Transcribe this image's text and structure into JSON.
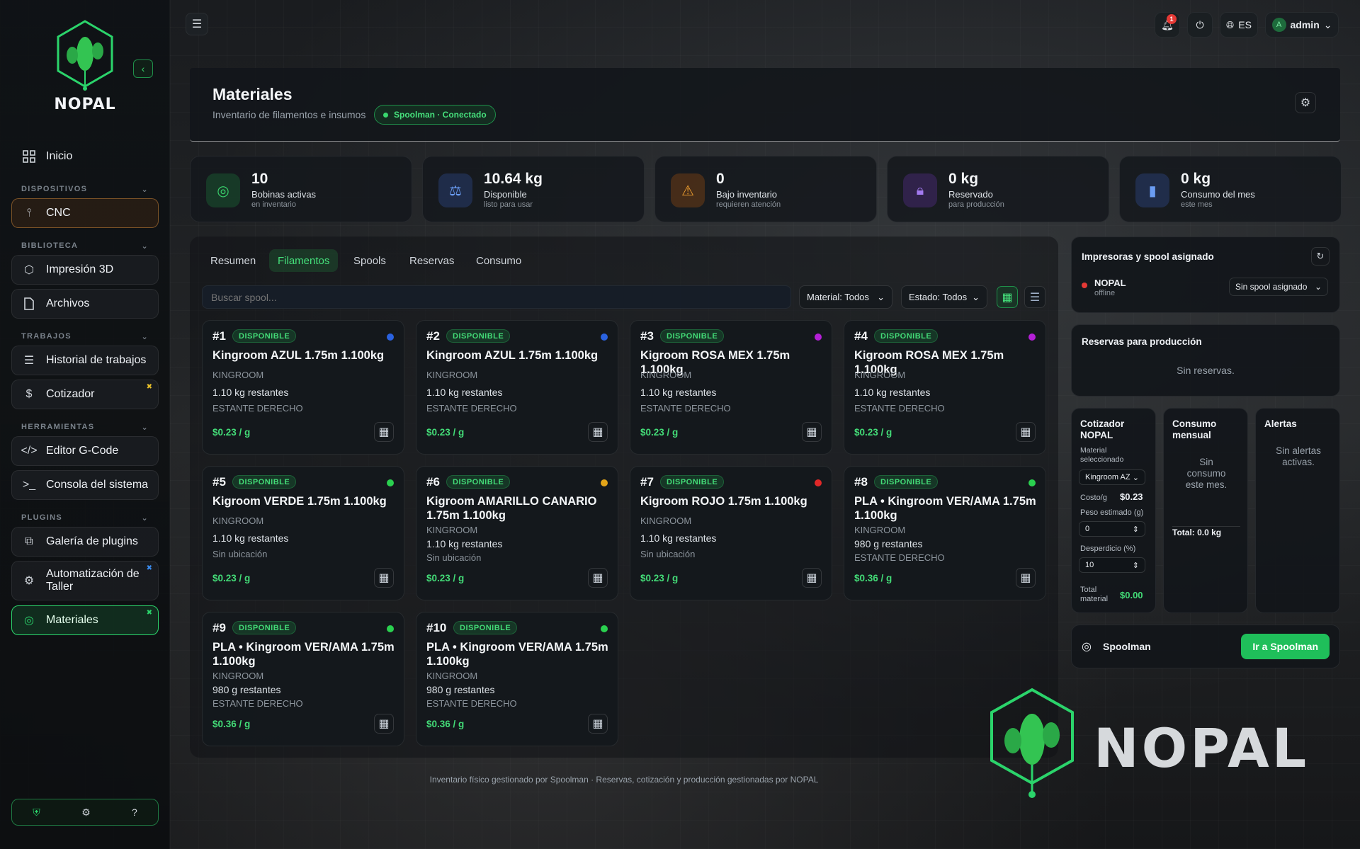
{
  "app": {
    "brand": "NOPAL",
    "colors": {
      "accent": "#2bd46b",
      "background": "#121417",
      "panel": "#14181c",
      "warning": "#e0a030"
    }
  },
  "sidebar": {
    "sections": {
      "dispositivos": "DISPOSITIVOS",
      "biblioteca": "BIBLIOTECA",
      "trabajos": "TRABAJOS",
      "herramientas": "HERRAMIENTAS",
      "plugins": "PLUGINS"
    },
    "items": {
      "inicio": "Inicio",
      "cnc": "CNC",
      "impresion": "Impresión 3D",
      "archivos": "Archivos",
      "historial": "Historial de trabajos",
      "cotizador": "Cotizador",
      "editor": "Editor G-Code",
      "consola": "Consola del sistema",
      "galeria": "Galería de plugins",
      "automatizacion": "Automatización de Taller",
      "materiales": "Materiales"
    }
  },
  "topbar": {
    "notifications_count": "1",
    "language": "ES",
    "user": "admin",
    "avatar_letter": "A"
  },
  "header": {
    "title": "Materiales",
    "subtitle": "Inventario de filamentos e insumos",
    "status": "Spoolman · Conectado"
  },
  "stats": [
    {
      "value": "10",
      "label": "Bobinas activas",
      "sub": "en inventario",
      "icon": "target-icon"
    },
    {
      "value": "10.64 kg",
      "label": "Disponible",
      "sub": "listo para usar",
      "icon": "scale-icon"
    },
    {
      "value": "0",
      "label": "Bajo inventario",
      "sub": "requieren atención",
      "icon": "warning-icon"
    },
    {
      "value": "0 kg",
      "label": "Reservado",
      "sub": "para producción",
      "icon": "lock-icon"
    },
    {
      "value": "0 kg",
      "label": "Consumo del mes",
      "sub": "este mes",
      "icon": "bar-chart-icon"
    }
  ],
  "tabs": [
    "Resumen",
    "Filamentos",
    "Spools",
    "Reservas",
    "Consumo"
  ],
  "filters": {
    "search_placeholder": "Buscar spool...",
    "material": "Material: Todos",
    "estado": "Estado: Todos"
  },
  "spools": [
    {
      "num": "#1",
      "status": "DISPONIBLE",
      "color": "#2a62e0",
      "name": "Kingroom AZUL 1.75m 1.100kg",
      "brand": "KINGROOM",
      "remaining": "1.10 kg restantes",
      "location": "ESTANTE DERECHO",
      "price": "$0.23 / g"
    },
    {
      "num": "#2",
      "status": "DISPONIBLE",
      "color": "#2a62e0",
      "name": "Kingroom AZUL 1.75m 1.100kg",
      "brand": "KINGROOM",
      "remaining": "1.10 kg restantes",
      "location": "ESTANTE DERECHO",
      "price": "$0.23 / g"
    },
    {
      "num": "#3",
      "status": "DISPONIBLE",
      "color": "#b41fd6",
      "name": "Kigroom ROSA MEX 1.75m 1.100kg",
      "brand": "KINGROOM",
      "remaining": "1.10 kg restantes",
      "location": "ESTANTE DERECHO",
      "price": "$0.23 / g"
    },
    {
      "num": "#4",
      "status": "DISPONIBLE",
      "color": "#b41fd6",
      "name": "Kigroom ROSA MEX 1.75m 1.100kg",
      "brand": "KINGROOM",
      "remaining": "1.10 kg restantes",
      "location": "ESTANTE DERECHO",
      "price": "$0.23 / g"
    },
    {
      "num": "#5",
      "status": "DISPONIBLE",
      "color": "#2ad04f",
      "name": "Kigroom VERDE 1.75m 1.100kg",
      "brand": "KINGROOM",
      "remaining": "1.10 kg restantes",
      "location": "Sin ubicación",
      "price": "$0.23 / g"
    },
    {
      "num": "#6",
      "status": "DISPONIBLE",
      "color": "#e3a418",
      "name": "Kigroom AMARILLO CANARIO 1.75m 1.100kg",
      "brand": "KINGROOM",
      "remaining": "1.10 kg restantes",
      "location": "Sin ubicación",
      "price": "$0.23 / g"
    },
    {
      "num": "#7",
      "status": "DISPONIBLE",
      "color": "#e02828",
      "name": "Kigroom ROJO 1.75m 1.100kg",
      "brand": "KINGROOM",
      "remaining": "1.10 kg restantes",
      "location": "Sin ubicación",
      "price": "$0.23 / g"
    },
    {
      "num": "#8",
      "status": "DISPONIBLE",
      "color": "#2ad04f",
      "name": "PLA • Kingroom VER/AMA 1.75m 1.100kg",
      "brand": "KINGROOM",
      "remaining": "980 g restantes",
      "location": "ESTANTE DERECHO",
      "price": "$0.36 / g"
    },
    {
      "num": "#9",
      "status": "DISPONIBLE",
      "color": "#2ad04f",
      "name": "PLA • Kingroom VER/AMA 1.75m 1.100kg",
      "brand": "KINGROOM",
      "remaining": "980 g restantes",
      "location": "ESTANTE DERECHO",
      "price": "$0.36 / g"
    },
    {
      "num": "#10",
      "status": "DISPONIBLE",
      "color": "#2ad04f",
      "name": "PLA • Kingroom VER/AMA 1.75m 1.100kg",
      "brand": "KINGROOM",
      "remaining": "980 g restantes",
      "location": "ESTANTE DERECHO",
      "price": "$0.36 / g"
    }
  ],
  "printers_panel": {
    "title": "Impresoras y spool asignado",
    "printer_name": "NOPAL",
    "printer_status": "offline",
    "spool_select": "Sin spool asignado"
  },
  "reservas_panel": {
    "title": "Reservas para producción",
    "empty": "Sin reservas."
  },
  "cotizador_panel": {
    "title": "Cotizador NOPAL",
    "material_label": "Material seleccionado",
    "material_value": "Kingroom AZ",
    "cost_label": "Costo/g",
    "cost_value": "$0.23",
    "weight_label": "Peso estimado (g)",
    "weight_value": "0",
    "waste_label": "Desperdicio (%)",
    "waste_value": "10",
    "total_label": "Total material",
    "total_value": "$0.00"
  },
  "consumo_panel": {
    "title": "Consumo mensual",
    "empty": "Sin consumo este mes.",
    "total": "Total: 0.0 kg"
  },
  "alertas_panel": {
    "title": "Alertas",
    "empty": "Sin alertas activas."
  },
  "spoolman_panel": {
    "label": "Spoolman",
    "button": "Ir a Spoolman"
  },
  "footer": {
    "note": "Inventario físico gestionado por Spoolman · Reservas, cotización y producción gestionadas por NOPAL"
  },
  "brand_mark": {
    "text": "NOPAL"
  }
}
